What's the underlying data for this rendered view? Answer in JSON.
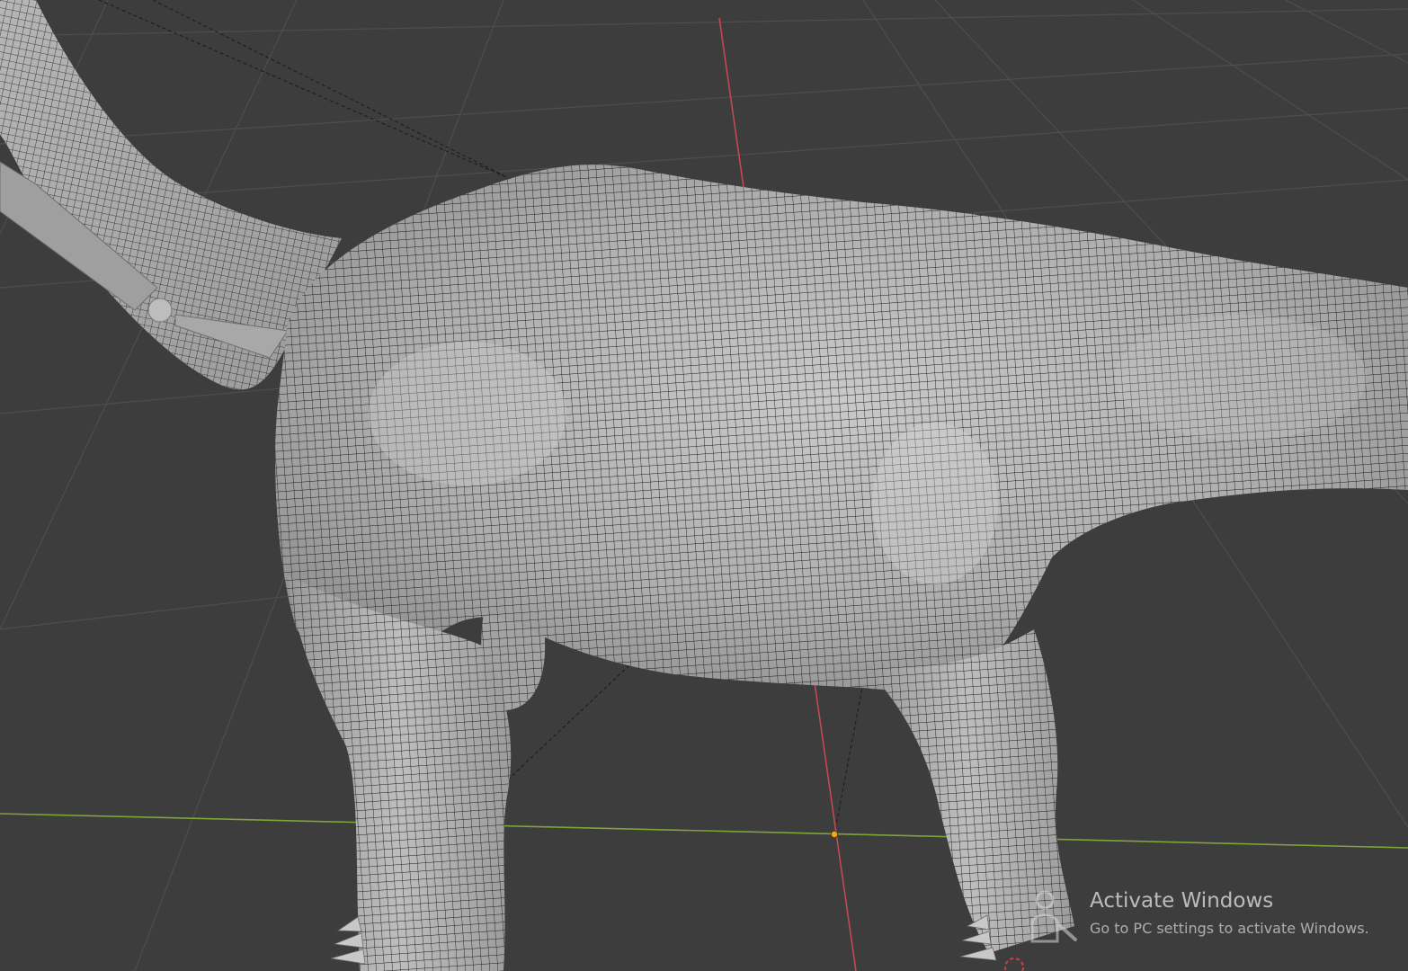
{
  "viewport": {
    "name": "3D Viewport",
    "background_color": "#3d3d3d",
    "grid_color": "#4f4f4f",
    "x_axis_color": "#c04a55",
    "y_axis_color": "#7fa437",
    "object": "dinosaur mesh (sauropod body, wireframe overlay)",
    "mesh_color": "#b9b9b9",
    "wire_color": "#1e1e1e",
    "origin_color": "#f5a623"
  },
  "watermark": {
    "title": "Activate Windows",
    "subtitle": "Go to PC settings to activate Windows.",
    "icon": "person-watermark-icon"
  }
}
